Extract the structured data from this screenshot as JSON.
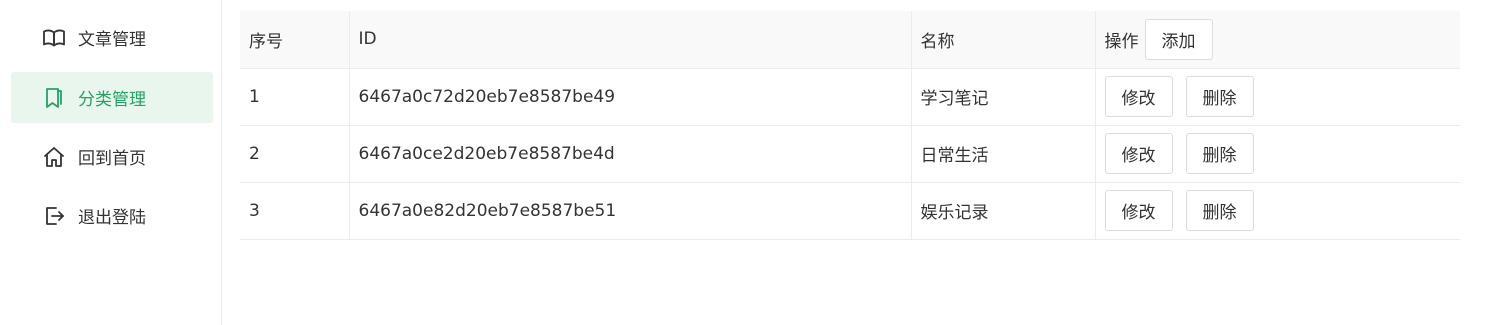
{
  "sidebar": {
    "items": [
      {
        "label": "文章管理",
        "icon": "book-open-icon",
        "active": false
      },
      {
        "label": "分类管理",
        "icon": "bookmark-icon",
        "active": true
      },
      {
        "label": "回到首页",
        "icon": "home-icon",
        "active": false
      },
      {
        "label": "退出登陆",
        "icon": "logout-icon",
        "active": false
      }
    ]
  },
  "table": {
    "headers": {
      "index": "序号",
      "id": "ID",
      "name": "名称",
      "actions": "操作"
    },
    "add_label": "添加",
    "edit_label": "修改",
    "delete_label": "删除",
    "rows": [
      {
        "index": "1",
        "id": "6467a0c72d20eb7e8587be49",
        "name": "学习笔记"
      },
      {
        "index": "2",
        "id": "6467a0ce2d20eb7e8587be4d",
        "name": "日常生活"
      },
      {
        "index": "3",
        "id": "6467a0e82d20eb7e8587be51",
        "name": "娱乐记录"
      }
    ]
  },
  "colors": {
    "accent": "#21a464",
    "active_bg": "#e8f6ee",
    "header_bg": "#f9f9f9",
    "border": "#ececec"
  }
}
